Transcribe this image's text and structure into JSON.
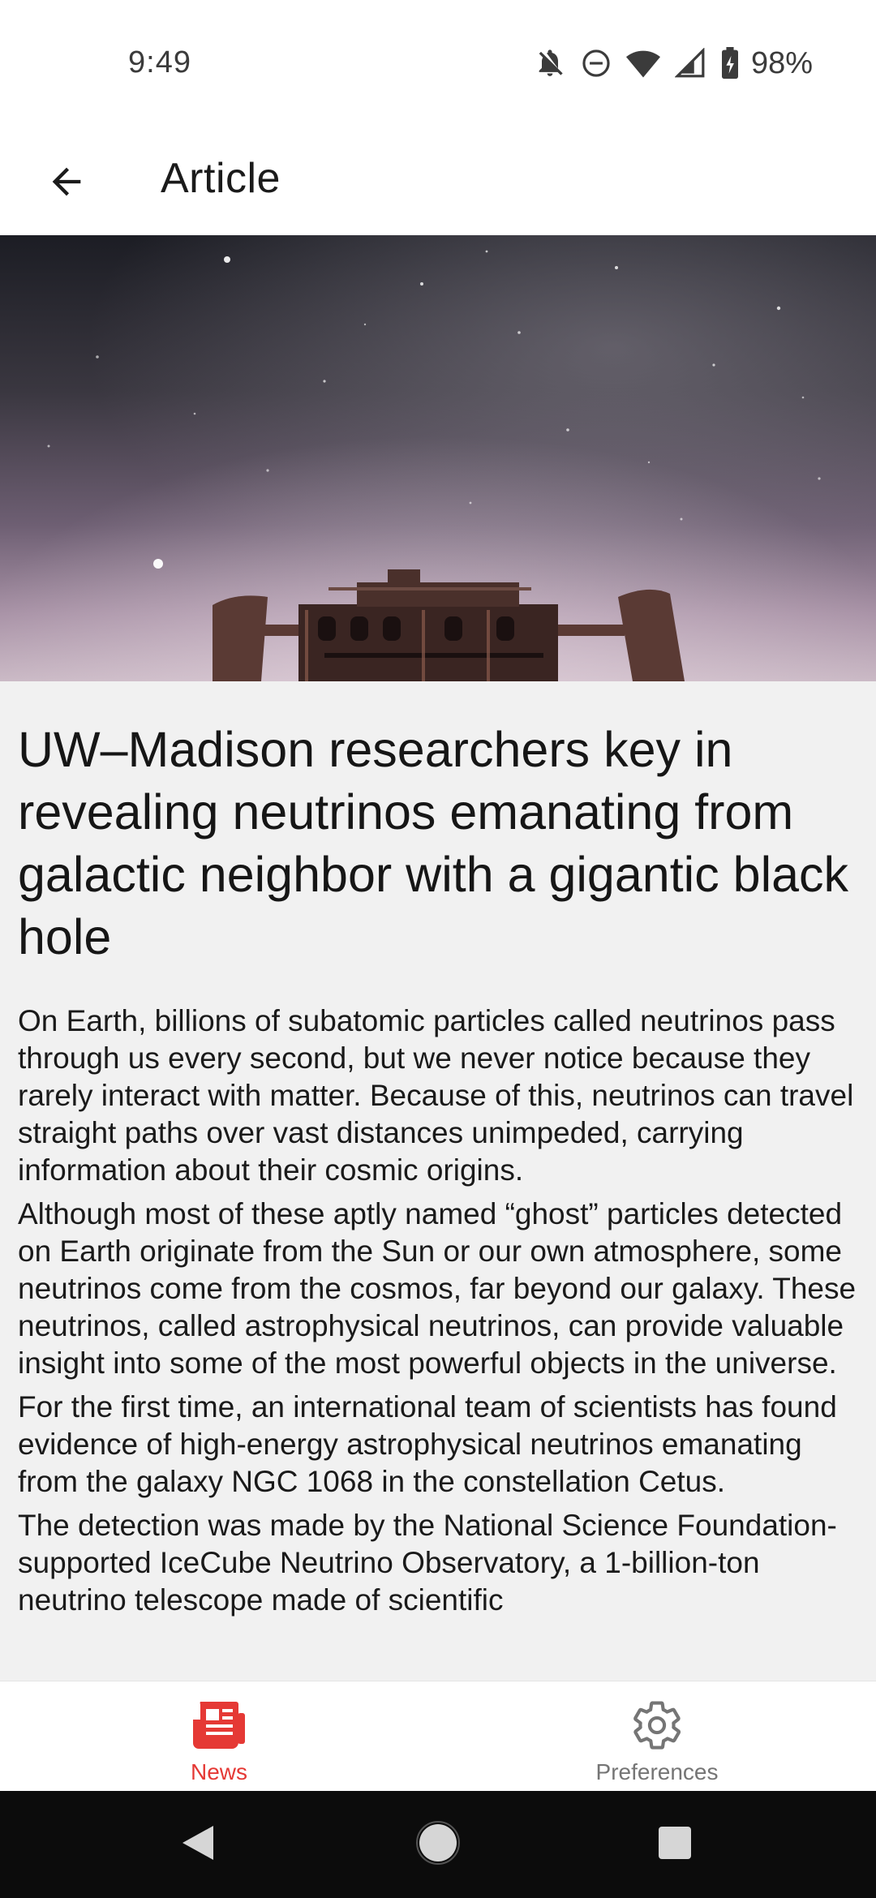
{
  "status_bar": {
    "time": "9:49",
    "battery": "98%",
    "icons": [
      "notifications-off-icon",
      "do-not-disturb-icon",
      "wifi-icon",
      "cellular-signal-icon",
      "battery-charging-icon"
    ]
  },
  "app_bar": {
    "back_icon": "arrow-back-icon",
    "title": "Article"
  },
  "hero": {
    "image": "night-sky-observatory-photo"
  },
  "article": {
    "headline": "UW–Madison researchers key in revealing neutrinos emanating from galactic neighbor with a gigantic black hole",
    "paragraphs": [
      "On Earth, billions of subatomic particles called neutrinos pass through us every second, but we never notice because they rarely interact with matter. Because of this, neutrinos can travel straight paths over vast distances unimpeded, carrying information about their cosmic origins.",
      "Although most of these aptly named “ghost” particles detected on Earth originate from the Sun or our own atmosphere, some neutrinos come from the cosmos, far beyond our galaxy. These neutrinos, called astrophysical neutrinos, can provide valuable insight into some of the most powerful objects in the universe.",
      "For the first time, an international team of scientists has found evidence of high-energy astrophysical neutrinos emanating from the galaxy NGC 1068 in the constellation Cetus.",
      "The detection was made by the National Science Foundation-supported IceCube Neutrino Observatory, a 1-billion-ton neutrino telescope made of scientific"
    ]
  },
  "bottom_nav": {
    "items": [
      {
        "label": "News",
        "icon": "newspaper-icon",
        "active": true
      },
      {
        "label": "Preferences",
        "icon": "gear-icon",
        "active": false
      }
    ],
    "active_color": "#e53935",
    "inactive_color": "#757575"
  },
  "system_nav": {
    "buttons": [
      "back-triangle-icon",
      "home-circle-icon",
      "recents-square-icon"
    ]
  }
}
